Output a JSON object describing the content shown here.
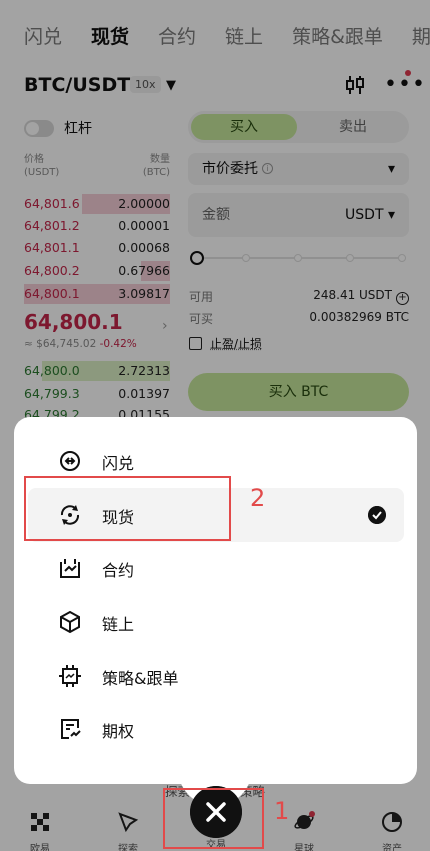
{
  "tabs": [
    "闪兑",
    "现货",
    "合约",
    "链上",
    "策略&跟单",
    "期"
  ],
  "active_tab": "现货",
  "pair": {
    "symbol": "BTC/USDT",
    "leverage": "10x"
  },
  "lever_label": "杠杆",
  "orderbook": {
    "price_header": "价格",
    "price_unit": "(USDT)",
    "qty_header": "数量",
    "qty_unit": "(BTC)",
    "asks": [
      {
        "price": "64,801.6",
        "qty": "2.00000",
        "depth": 0.6
      },
      {
        "price": "64,801.2",
        "qty": "0.00001",
        "depth": 0.0
      },
      {
        "price": "64,801.1",
        "qty": "0.00068",
        "depth": 0.0
      },
      {
        "price": "64,800.2",
        "qty": "0.67966",
        "depth": 0.2
      },
      {
        "price": "64,800.1",
        "qty": "3.09817",
        "depth": 1.0
      }
    ],
    "mid_price": "64,800.1",
    "mid_usd": "≈ $64,745.02",
    "mid_change": "-0.42%",
    "bids": [
      {
        "price": "64,800.0",
        "qty": "2.72313",
        "depth": 0.88
      },
      {
        "price": "64,799.3",
        "qty": "0.01397",
        "depth": 0.0
      },
      {
        "price": "64,799.2",
        "qty": "0.01155",
        "depth": 0.0
      }
    ]
  },
  "order": {
    "buy_label": "买入",
    "sell_label": "卖出",
    "order_type": "市价委托",
    "amount_label": "金额",
    "amount_unit": "USDT",
    "available_label": "可用",
    "available_value": "248.41 USDT",
    "can_buy_label": "可买",
    "can_buy_value": "0.00382969 BTC",
    "tpsl_label": "止盈/止损",
    "submit_label": "买入 BTC"
  },
  "background_hint": "探索不同交易策略",
  "menu": {
    "items": [
      {
        "label": "闪兑",
        "icon": "swap-circle-icon"
      },
      {
        "label": "现货",
        "icon": "spot-refresh-icon",
        "selected": true
      },
      {
        "label": "合约",
        "icon": "contract-icon"
      },
      {
        "label": "链上",
        "icon": "onchain-cube-icon"
      },
      {
        "label": "策略&跟单",
        "icon": "bot-icon"
      },
      {
        "label": "期权",
        "icon": "options-icon"
      }
    ]
  },
  "nav": {
    "items": [
      {
        "label": "欧易",
        "icon": "okx-logo-icon"
      },
      {
        "label": "探索",
        "icon": "compass-icon"
      },
      {
        "label": "交易",
        "icon": "close-icon"
      },
      {
        "label": "星球",
        "icon": "planet-icon"
      },
      {
        "label": "资产",
        "icon": "pie-chart-icon"
      }
    ]
  },
  "annotations": [
    "1",
    "2"
  ],
  "colors": {
    "buy": "#c6e79b",
    "ask": "#c4264a",
    "bid": "#2c7a31",
    "annotation": "#e24a4a"
  }
}
